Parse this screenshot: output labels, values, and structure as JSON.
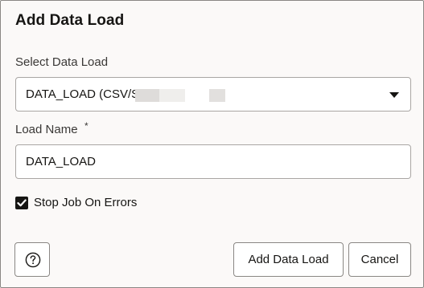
{
  "dialog": {
    "title": "Add Data Load"
  },
  "select_data_load": {
    "label": "Select Data Load",
    "value": "DATA_LOAD (CSV/S"
  },
  "load_name": {
    "label": "Load Name",
    "required_marker": "*",
    "value": "DATA_LOAD"
  },
  "stop_job": {
    "label": "Stop Job On Errors",
    "checked": true
  },
  "footer": {
    "help_icon": "question-circle-icon",
    "add_label": "Add Data Load",
    "cancel_label": "Cancel"
  }
}
